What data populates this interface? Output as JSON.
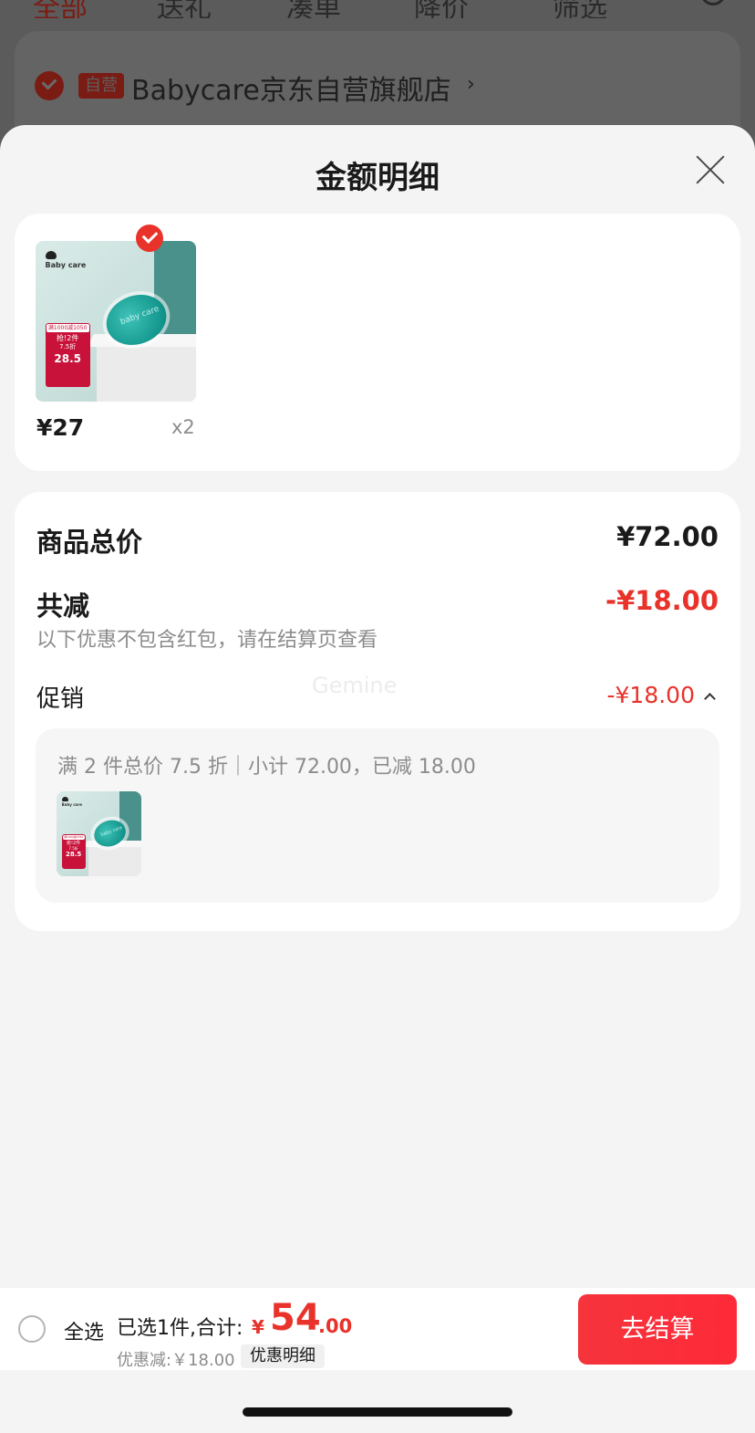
{
  "background": {
    "tabs": [
      {
        "label": "全部",
        "active": true
      },
      {
        "label": "送礼",
        "active": false
      },
      {
        "label": "凑单",
        "active": false
      },
      {
        "label": "降价",
        "active": false
      },
      {
        "label": "筛选",
        "active": false
      }
    ],
    "shop": {
      "badge": "自营",
      "name": "Babycare京东自营旗舰店",
      "arrow": "›"
    }
  },
  "sheet": {
    "title": "金额明细",
    "product": {
      "image_logo": "Baby care",
      "image_pacifier_text": "baby care",
      "image_promo": {
        "line1": "满1000减1050",
        "line2": "抢!2件",
        "line3": "7.5折",
        "line4": "28.5"
      },
      "price": "¥27",
      "quantity": "x2",
      "selected": true
    },
    "summary": {
      "total_label": "商品总价",
      "total_value": "¥72.00",
      "reduction_label": "共减",
      "reduction_value": "-¥18.00",
      "note": "以下优惠不包含红包，请在结算页查看",
      "promo_label": "促销",
      "promo_value": "-¥18.00",
      "promo_detail": "满 2 件总价 7.5 折｜小计 72.00，已减 18.00",
      "watermark": "Gemine"
    }
  },
  "bottom_bar": {
    "select_all": "全选",
    "selected_summary": "已选1件,合计:",
    "currency": "¥",
    "total_integer": "54",
    "total_decimal": ".00",
    "discount": "优惠减:￥18.00",
    "detail_button": "优惠明细",
    "checkout": "去结算"
  },
  "colors": {
    "accent": "#e8322a",
    "overlay": "#5b5b5b",
    "sheet_bg": "#f4f4f4"
  }
}
